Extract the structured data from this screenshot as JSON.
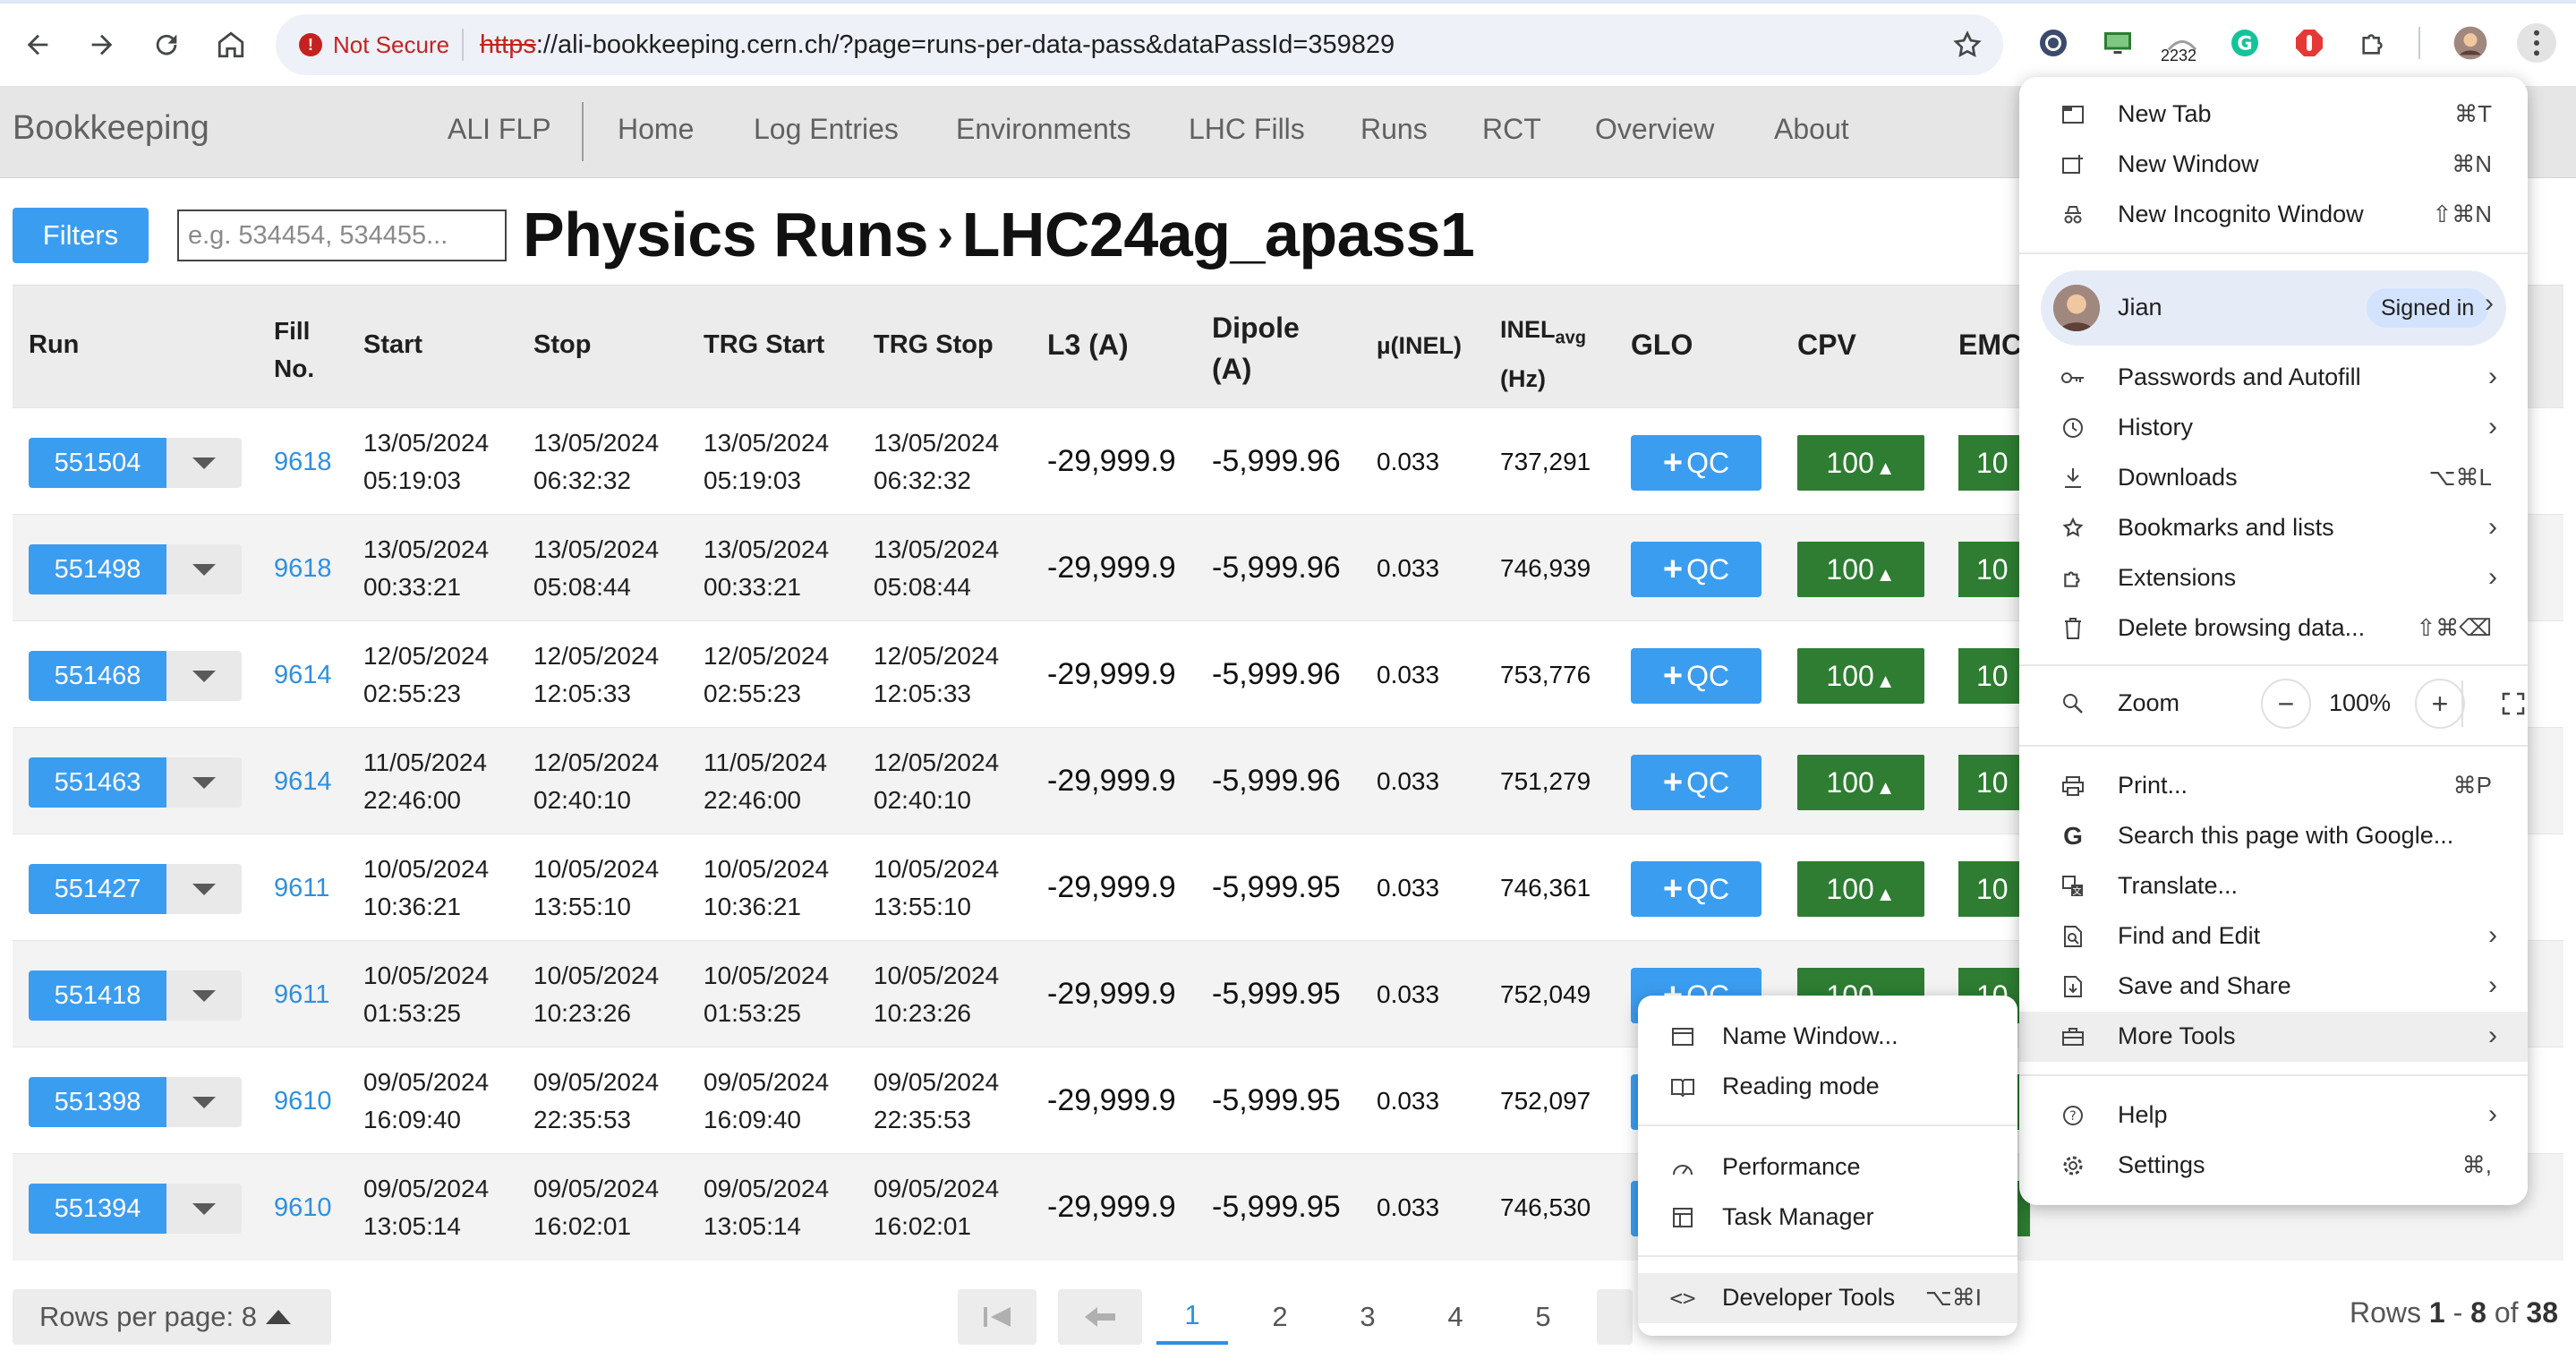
{
  "browser": {
    "security_label": "Not Secure",
    "url_scheme": "https",
    "url_rest": "://ali-bookkeeping.cern.ch/?page=runs-per-data-pass&dataPassId=359829",
    "ext_badge": "2232"
  },
  "nav": {
    "brand": "Bookkeeping",
    "links": [
      "ALI FLP",
      "Home",
      "Log Entries",
      "Environments",
      "LHC Fills",
      "Runs",
      "RCT",
      "Overview",
      "About"
    ]
  },
  "header": {
    "filters_label": "Filters",
    "search_placeholder": "e.g. 534454, 534455...",
    "title_main": "Physics Runs",
    "title_sub": "LHC24ag_apass1"
  },
  "table": {
    "columns": {
      "run": "Run",
      "fill_1": "Fill",
      "fill_2": "No.",
      "start": "Start",
      "stop": "Stop",
      "trg_start": "TRG Start",
      "trg_stop": "TRG Stop",
      "l3": "L3 (A)",
      "dipole_1": "Dipole",
      "dipole_2": "(A)",
      "mu": "µ(INEL)",
      "inel_1": "INEL",
      "inel_sub": "avg",
      "inel_2": "(Hz)",
      "glo": "GLO",
      "cpv": "CPV",
      "emc": "EMC"
    },
    "qc_label": "QC",
    "cpv_value": "100",
    "emc_value": "10",
    "rows": [
      {
        "run": "551504",
        "fill": "9618",
        "start_d": "13/05/2024",
        "start_t": "05:19:03",
        "stop_d": "13/05/2024",
        "stop_t": "06:32:32",
        "trgs_d": "13/05/2024",
        "trgs_t": "05:19:03",
        "trge_d": "13/05/2024",
        "trge_t": "06:32:32",
        "l3": "-29,999.9",
        "dipole": "-5,999.96",
        "mu": "0.033",
        "inel": "737,291"
      },
      {
        "run": "551498",
        "fill": "9618",
        "start_d": "13/05/2024",
        "start_t": "00:33:21",
        "stop_d": "13/05/2024",
        "stop_t": "05:08:44",
        "trgs_d": "13/05/2024",
        "trgs_t": "00:33:21",
        "trge_d": "13/05/2024",
        "trge_t": "05:08:44",
        "l3": "-29,999.9",
        "dipole": "-5,999.96",
        "mu": "0.033",
        "inel": "746,939"
      },
      {
        "run": "551468",
        "fill": "9614",
        "start_d": "12/05/2024",
        "start_t": "02:55:23",
        "stop_d": "12/05/2024",
        "stop_t": "12:05:33",
        "trgs_d": "12/05/2024",
        "trgs_t": "02:55:23",
        "trge_d": "12/05/2024",
        "trge_t": "12:05:33",
        "l3": "-29,999.9",
        "dipole": "-5,999.96",
        "mu": "0.033",
        "inel": "753,776"
      },
      {
        "run": "551463",
        "fill": "9614",
        "start_d": "11/05/2024",
        "start_t": "22:46:00",
        "stop_d": "12/05/2024",
        "stop_t": "02:40:10",
        "trgs_d": "11/05/2024",
        "trgs_t": "22:46:00",
        "trge_d": "12/05/2024",
        "trge_t": "02:40:10",
        "l3": "-29,999.9",
        "dipole": "-5,999.96",
        "mu": "0.033",
        "inel": "751,279"
      },
      {
        "run": "551427",
        "fill": "9611",
        "start_d": "10/05/2024",
        "start_t": "10:36:21",
        "stop_d": "10/05/2024",
        "stop_t": "13:55:10",
        "trgs_d": "10/05/2024",
        "trgs_t": "10:36:21",
        "trge_d": "10/05/2024",
        "trge_t": "13:55:10",
        "l3": "-29,999.9",
        "dipole": "-5,999.95",
        "mu": "0.033",
        "inel": "746,361"
      },
      {
        "run": "551418",
        "fill": "9611",
        "start_d": "10/05/2024",
        "start_t": "01:53:25",
        "stop_d": "10/05/2024",
        "stop_t": "10:23:26",
        "trgs_d": "10/05/2024",
        "trgs_t": "01:53:25",
        "trge_d": "10/05/2024",
        "trge_t": "10:23:26",
        "l3": "-29,999.9",
        "dipole": "-5,999.95",
        "mu": "0.033",
        "inel": "752,049"
      },
      {
        "run": "551398",
        "fill": "9610",
        "start_d": "09/05/2024",
        "start_t": "16:09:40",
        "stop_d": "09/05/2024",
        "stop_t": "22:35:53",
        "trgs_d": "09/05/2024",
        "trgs_t": "16:09:40",
        "trge_d": "09/05/2024",
        "trge_t": "22:35:53",
        "l3": "-29,999.9",
        "dipole": "-5,999.95",
        "mu": "0.033",
        "inel": "752,097"
      },
      {
        "run": "551394",
        "fill": "9610",
        "start_d": "09/05/2024",
        "start_t": "13:05:14",
        "stop_d": "09/05/2024",
        "stop_t": "16:02:01",
        "trgs_d": "09/05/2024",
        "trgs_t": "13:05:14",
        "trge_d": "09/05/2024",
        "trge_t": "16:02:01",
        "l3": "-29,999.9",
        "dipole": "-5,999.95",
        "mu": "0.033",
        "inel": "746,530"
      }
    ]
  },
  "footer": {
    "rows_per_page": "Rows per page: 8",
    "pages": [
      "1",
      "2",
      "3",
      "4",
      "5"
    ],
    "rows_label": "Rows",
    "rows_from": "1",
    "rows_to": "8",
    "rows_of": "of",
    "rows_total": "38"
  },
  "chrome_menu": {
    "new_tab": "New Tab",
    "new_tab_sc": "⌘T",
    "new_window": "New Window",
    "new_window_sc": "⌘N",
    "incognito": "New Incognito Window",
    "incognito_sc": "⇧⌘N",
    "profile_name": "Jian",
    "signed_in": "Signed in",
    "passwords": "Passwords and Autofill",
    "history": "History",
    "downloads": "Downloads",
    "downloads_sc": "⌥⌘L",
    "bookmarks": "Bookmarks and lists",
    "extensions": "Extensions",
    "delete": "Delete browsing data...",
    "delete_sc": "⇧⌘⌫",
    "zoom": "Zoom",
    "zoom_value": "100%",
    "print": "Print...",
    "print_sc": "⌘P",
    "search_google": "Search this page with Google...",
    "translate": "Translate...",
    "find": "Find and Edit",
    "save_share": "Save and Share",
    "more_tools": "More Tools",
    "help": "Help",
    "settings": "Settings",
    "settings_sc": "⌘,"
  },
  "more_tools_menu": {
    "name_window": "Name Window...",
    "reading_mode": "Reading mode",
    "performance": "Performance",
    "task_manager": "Task Manager",
    "dev_tools": "Developer Tools",
    "dev_tools_sc": "⌥⌘I"
  }
}
